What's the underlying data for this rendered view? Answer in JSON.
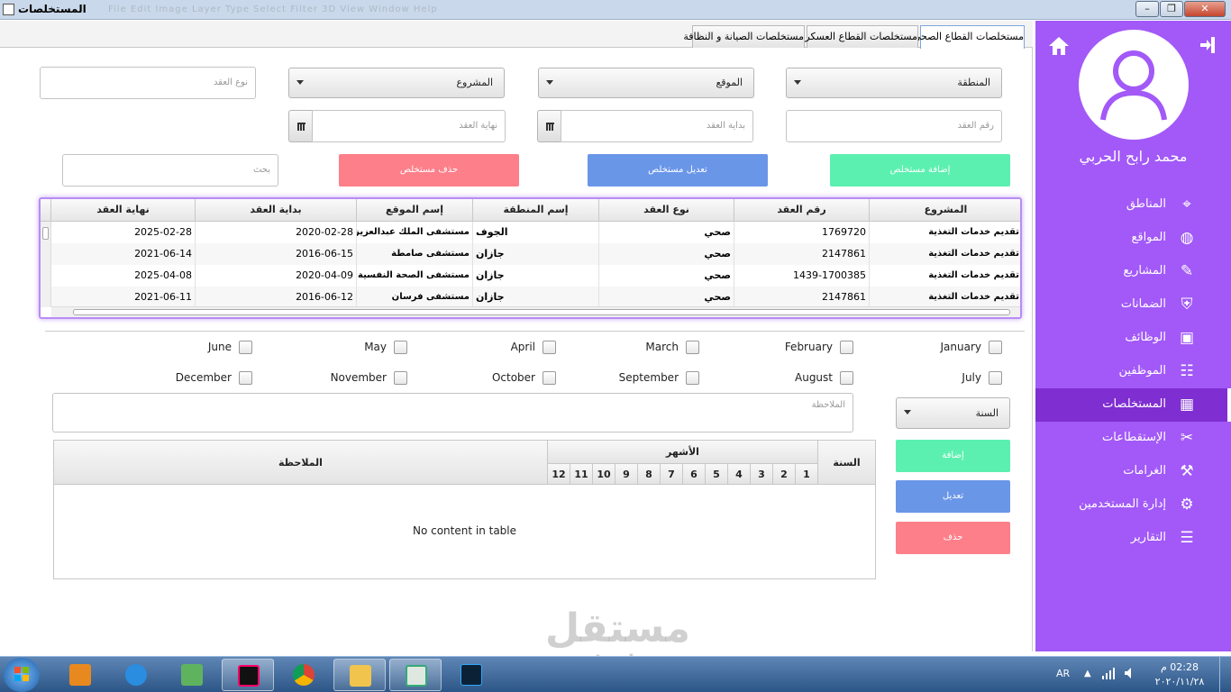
{
  "window": {
    "title": "المستخلصات",
    "ghost_menu": "File   Edit   Image   Layer   Type   Select   Filter   3D   View   Window   Help"
  },
  "tabs": [
    "مستخلصات القطاع الصحي",
    "مستخلصات القطاع العسكري",
    "مستخلصات الصيانة و النظافة"
  ],
  "form": {
    "region": "المنطقة",
    "site": "الموقع",
    "project": "المشروع",
    "contract_type_placeholder": "نوع العقد",
    "contract_no_placeholder": "رقم العقد",
    "contract_start_placeholder": "بداية العقد",
    "contract_end_placeholder": "نهاية العقد",
    "search_placeholder": "بحث",
    "add_button": "إضافة مستخلص",
    "edit_button": "تعديل مستخلص",
    "delete_button": "حذف مستخلص"
  },
  "table": {
    "columns": [
      "المشروع",
      "رقم العقد",
      "نوع العقد",
      "إسم المنطقة",
      "إسم الموقع",
      "بداية العقد",
      "نهاية العقد"
    ],
    "rows": [
      [
        "تقديم خدمات التغذية",
        "1769720",
        "صحي",
        "الجوف",
        "مستشفى الملك عبدالعزيز",
        "2020-02-28",
        "2025-02-28"
      ],
      [
        "تقديم خدمات التغذية",
        "2147861",
        "صحي",
        "جازان",
        "مستشفى صامطة",
        "2016-06-15",
        "2021-06-14"
      ],
      [
        "تقديم خدمات التغذية",
        "1439-1700385",
        "صحي",
        "جازان",
        "مستشفى الصحة النفسية",
        "2020-04-09",
        "2025-04-08"
      ],
      [
        "تقديم خدمات التغذية",
        "2147861",
        "صحي",
        "جازان",
        "مستشفى فرسان",
        "2016-06-12",
        "2021-06-11"
      ]
    ]
  },
  "months": [
    "January",
    "February",
    "March",
    "April",
    "May",
    "June",
    "July",
    "August",
    "September",
    "October",
    "November",
    "December"
  ],
  "notes_placeholder": "الملاحظة",
  "year_combo": "السنة",
  "side_buttons": {
    "add": "إضافة",
    "edit": "تعديل",
    "delete": "حذف"
  },
  "table2": {
    "year_header": "السنة",
    "months_header": "الأشهر",
    "month_numbers": [
      "1",
      "2",
      "3",
      "4",
      "5",
      "6",
      "7",
      "8",
      "9",
      "10",
      "11",
      "12"
    ],
    "notes_header": "الملاحظة",
    "empty_text": "No content in table"
  },
  "sidebar": {
    "user_name": "محمد رابح الحربي",
    "items": [
      {
        "label": "المناطق",
        "icon": "map-icon"
      },
      {
        "label": "المواقع",
        "icon": "globe-icon"
      },
      {
        "label": "المشاريع",
        "icon": "edit-icon"
      },
      {
        "label": "الضمانات",
        "icon": "shield-icon"
      },
      {
        "label": "الوظائف",
        "icon": "briefcase-icon"
      },
      {
        "label": "الموظفين",
        "icon": "people-icon"
      },
      {
        "label": "المستخلصات",
        "icon": "calendar-icon"
      },
      {
        "label": "الإستقطاعات",
        "icon": "scissors-icon"
      },
      {
        "label": "الغرامات",
        "icon": "gavel-icon"
      },
      {
        "label": "إدارة المستخدمين",
        "icon": "user-settings-icon"
      },
      {
        "label": "التقارير",
        "icon": "report-icon"
      }
    ],
    "selected_index": 6
  },
  "taskbar": {
    "lang": "AR",
    "time": "02:28 م",
    "date": "٢٠٢٠/١١/٢٨"
  },
  "watermark": {
    "line1": "مستقل",
    "line2": "mostaql.com"
  },
  "colors": {
    "sidebar": "#a259f7",
    "sidebar_selected": "#7f2ed1",
    "add": "#5cf0b0",
    "edit": "#6a96e8",
    "delete": "#fd7f8a"
  }
}
